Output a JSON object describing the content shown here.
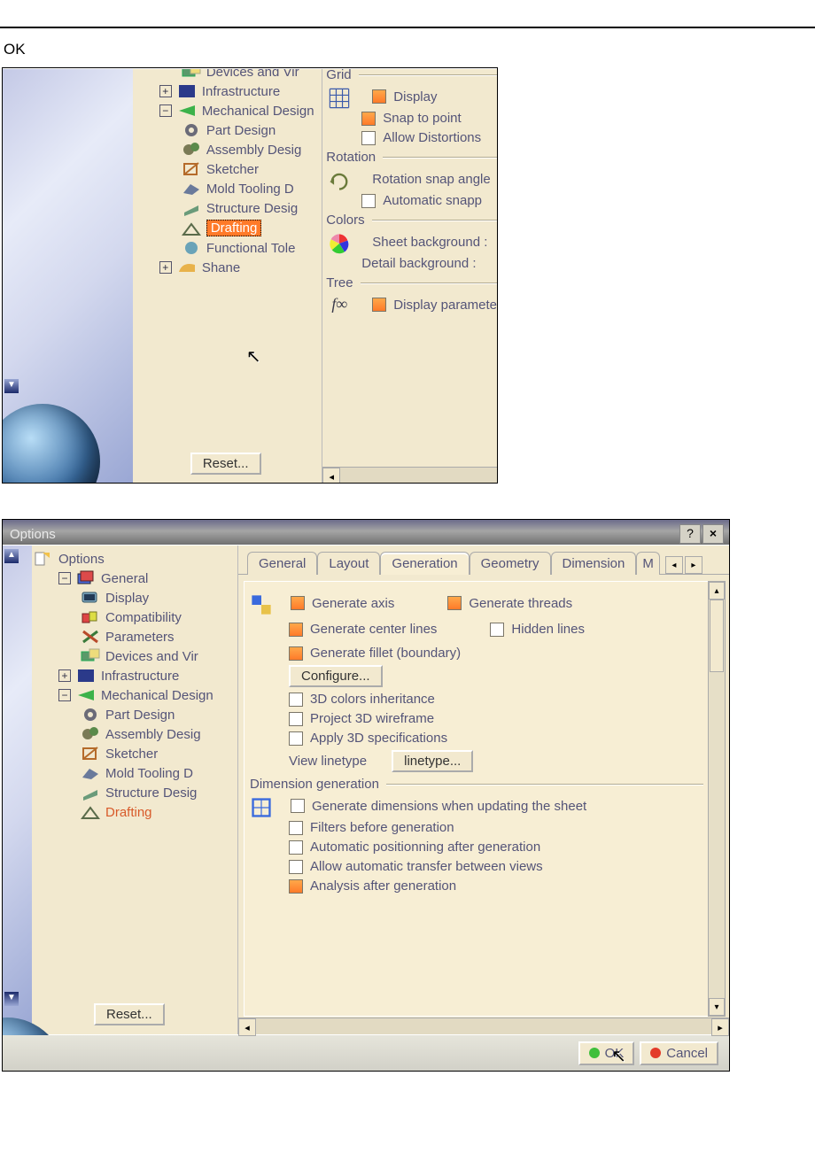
{
  "doc_caption": "OK",
  "colors": {
    "accent_orange": "#ff7a29",
    "tree_text": "#545478",
    "dot_green": "#3fbf3b",
    "dot_red": "#e33b2a"
  },
  "shot1": {
    "tree": {
      "items": [
        {
          "icon": "devices-icon",
          "label": "Devices and Vir",
          "level": 3
        },
        {
          "icon": "infrastructure-icon",
          "label": "Infrastructure",
          "level": 2,
          "plus": true
        },
        {
          "icon": "mechanical-icon",
          "label": "Mechanical Design",
          "level": 2,
          "expand": true
        },
        {
          "icon": "gear-icon",
          "label": "Part Design",
          "level": 3
        },
        {
          "icon": "gears-icon",
          "label": "Assembly Desig",
          "level": 3
        },
        {
          "icon": "sketcher-icon",
          "label": "Sketcher",
          "level": 3
        },
        {
          "icon": "mold-icon",
          "label": "Mold Tooling D",
          "level": 3
        },
        {
          "icon": "structure-icon",
          "label": "Structure Desig",
          "level": 3
        },
        {
          "icon": "drafting-icon",
          "label": "Drafting",
          "level": 3,
          "selected": true
        },
        {
          "icon": "functional-icon",
          "label": "Functional Tole",
          "level": 3
        },
        {
          "icon": "shape-icon",
          "label": "Shane",
          "level": 2,
          "plus": true
        }
      ],
      "reset_label": "Reset..."
    },
    "panel": {
      "groups": [
        {
          "title": "Grid",
          "icon": "grid-icon",
          "rows": [
            {
              "checked": true,
              "label": "Display"
            },
            {
              "checked": true,
              "label": "Snap to point"
            },
            {
              "checked": false,
              "label": "Allow Distortions"
            }
          ]
        },
        {
          "title": "Rotation",
          "icon": "rotation-icon",
          "rows": [
            {
              "plain": true,
              "label": "Rotation snap angle"
            },
            {
              "checked": false,
              "label": "Automatic snapp"
            }
          ]
        },
        {
          "title": "Colors",
          "icon": "color-wheel-icon",
          "rows": [
            {
              "plain": true,
              "label": "Sheet background :"
            },
            {
              "plain": true,
              "label": "Detail background :"
            }
          ]
        },
        {
          "title": "Tree",
          "icon": "fn-icon",
          "rows": [
            {
              "checked": true,
              "label": "Display paramete"
            }
          ]
        }
      ]
    }
  },
  "shot2": {
    "title": "Options",
    "tree": {
      "root": "Options",
      "items": [
        {
          "icon": "general-icon",
          "label": "General",
          "level": 2,
          "expand": true
        },
        {
          "icon": "display-icon",
          "label": "Display",
          "level": 3
        },
        {
          "icon": "compat-icon",
          "label": "Compatibility",
          "level": 3
        },
        {
          "icon": "parameters-icon",
          "label": "Parameters",
          "level": 3
        },
        {
          "icon": "devices-icon",
          "label": "Devices and Vir",
          "level": 3
        },
        {
          "icon": "infrastructure-icon",
          "label": "Infrastructure",
          "level": 2,
          "plus": true
        },
        {
          "icon": "mechanical-icon",
          "label": "Mechanical Design",
          "level": 2,
          "expand": true
        },
        {
          "icon": "gear-icon",
          "label": "Part Design",
          "level": 3
        },
        {
          "icon": "gears-icon",
          "label": "Assembly Desig",
          "level": 3
        },
        {
          "icon": "sketcher-icon",
          "label": "Sketcher",
          "level": 3
        },
        {
          "icon": "mold-icon",
          "label": "Mold Tooling D",
          "level": 3
        },
        {
          "icon": "structure-icon",
          "label": "Structure Desig",
          "level": 3
        },
        {
          "icon": "drafting-icon",
          "label": "Drafting",
          "level": 3,
          "selected": true
        }
      ],
      "reset_label": "Reset..."
    },
    "tabs": [
      "General",
      "Layout",
      "Generation",
      "Geometry",
      "Dimension"
    ],
    "tabs_overflow": "M",
    "active_tab_index": 2,
    "content": {
      "rows_top": [
        {
          "checked": true,
          "label": "Generate axis"
        },
        {
          "checked": true,
          "label": "Generate threads"
        }
      ],
      "rows_mid": [
        {
          "checked": true,
          "label": "Generate center lines"
        },
        {
          "checked": false,
          "label": "Hidden lines"
        }
      ],
      "row_fillet": {
        "checked": true,
        "label": "Generate fillet (boundary)"
      },
      "configure_label": "Configure...",
      "rows_geom": [
        {
          "checked": false,
          "label": "3D colors inheritance"
        },
        {
          "checked": false,
          "label": "Project 3D wireframe"
        },
        {
          "checked": false,
          "label": "Apply 3D specifications"
        }
      ],
      "linetype_label": "View linetype",
      "linetype_button": "linetype...",
      "dim_group": "Dimension generation",
      "rows_dim": [
        {
          "checked": false,
          "label": "Generate dimensions when updating the sheet"
        },
        {
          "checked": false,
          "label": "Filters before generation"
        },
        {
          "checked": false,
          "label": "Automatic positionning after generation"
        },
        {
          "checked": false,
          "label": "Allow automatic transfer between views"
        },
        {
          "checked": true,
          "label": "Analysis after generation"
        }
      ]
    },
    "footer": {
      "ok": "OK",
      "cancel": "Cancel"
    }
  }
}
